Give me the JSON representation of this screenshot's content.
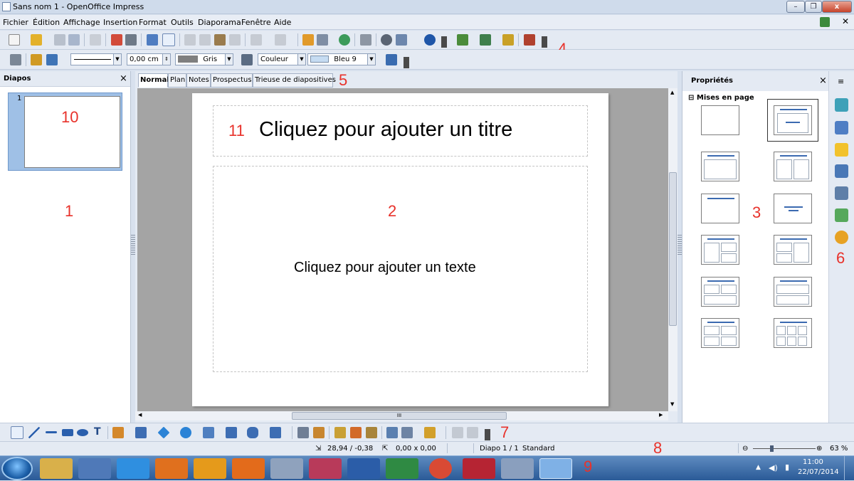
{
  "window": {
    "title": "Sans nom 1 - OpenOffice Impress",
    "minimize": "–",
    "restore": "❐",
    "close": "x"
  },
  "menu": [
    "Fichier",
    "Édition",
    "Affichage",
    "Insertion",
    "Format",
    "Outils",
    "Diaporama",
    "Fenêtre",
    "Aide"
  ],
  "line_toolbar": {
    "width_value": "0,00 cm",
    "line_color": "Gris",
    "fill_type": "Couleur",
    "fill_color": "Bleu 9"
  },
  "slides_panel": {
    "title": "Diapos",
    "close": "×",
    "thumb_number": "1"
  },
  "view_tabs": [
    "Normal",
    "Plan",
    "Notes",
    "Prospectus",
    "Trieuse de diapositives"
  ],
  "active_tab": "Normal",
  "slide": {
    "title_placeholder": "Cliquez pour ajouter un titre",
    "text_placeholder": "Cliquez pour ajouter un texte"
  },
  "properties": {
    "title": "Propriétés",
    "close": "×",
    "menu": "≡",
    "section": "Mises en page",
    "collapse": "⊟"
  },
  "hscroll_grip": "III",
  "annotations": [
    "1",
    "2",
    "3",
    "4",
    "5",
    "6",
    "7",
    "8",
    "9",
    "10",
    "11"
  ],
  "status": {
    "position": "28,94 / -0,38",
    "size": "0,00 x 0,00",
    "slide": "Diapo 1 / 1",
    "layout": "Standard",
    "zoom": "63 %"
  },
  "tray": {
    "time": "11:00",
    "date": "22/07/2014"
  },
  "colors": {
    "line_color": "#7f7f7f",
    "fill_color": "#c6dcf2",
    "annotation": "#e8322b",
    "layout_bar": "#3b6ab0"
  },
  "icons": {
    "taskbar": [
      "explorer-icon",
      "paint-icon",
      "internet-explorer-icon",
      "firefox-icon",
      "outlook-icon",
      "media-player-icon",
      "calculator-icon",
      "access-icon",
      "word-icon",
      "excel-icon",
      "chrome-icon",
      "acrobat-icon",
      "paint-palette-icon",
      "openoffice-icon"
    ]
  }
}
